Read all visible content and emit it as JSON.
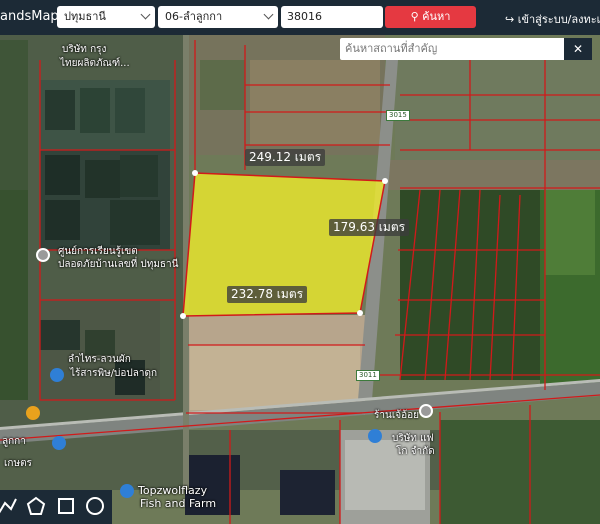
{
  "header": {
    "brand": "andsMaps",
    "province": "ปทุมธานี",
    "district": "06-ลำลูกกา",
    "parcel_no": "38016",
    "search_label": "ค้นหา",
    "login_label": "เข้าสู่ระบบ/ลงทะเบี"
  },
  "place_search": {
    "placeholder": "ค้นหาสถานที่สำคัญ",
    "close_label": "✕"
  },
  "measurements": {
    "top": "249.12 เมตร",
    "right": "179.63 เมตร",
    "bottom": "232.78 เมตร"
  },
  "map_labels": [
    "บริษัท กรุง",
    "ไทยผลิตภัณฑ์...",
    "ศูนย์การเรียนรู้เขต",
    "ปลอดภัยบ้านเลขที่ ปทุมธานี",
    "ลำไทร-ลวนผัก",
    "ไร้สารพิษ/บ่อปลาดุก",
    "ร้านเจ้อ้อย",
    "บริษัท แฟ",
    "โก จำกัด",
    "Topzwolflazy",
    "Fish and Farm",
    "ลูกกา",
    "เกษตร"
  ],
  "road_signs": [
    "3015",
    "3011"
  ],
  "colors": {
    "topbar": "#1c2a36",
    "search_button": "#e53941",
    "parcel_fill": "#f2ee2a",
    "boundary": "#d11a1a",
    "pin_blue": "#2f7fd6",
    "pin_orange": "#e8a21d"
  },
  "tools": [
    "polyline-tool",
    "polygon-tool",
    "rectangle-tool",
    "circle-tool"
  ]
}
